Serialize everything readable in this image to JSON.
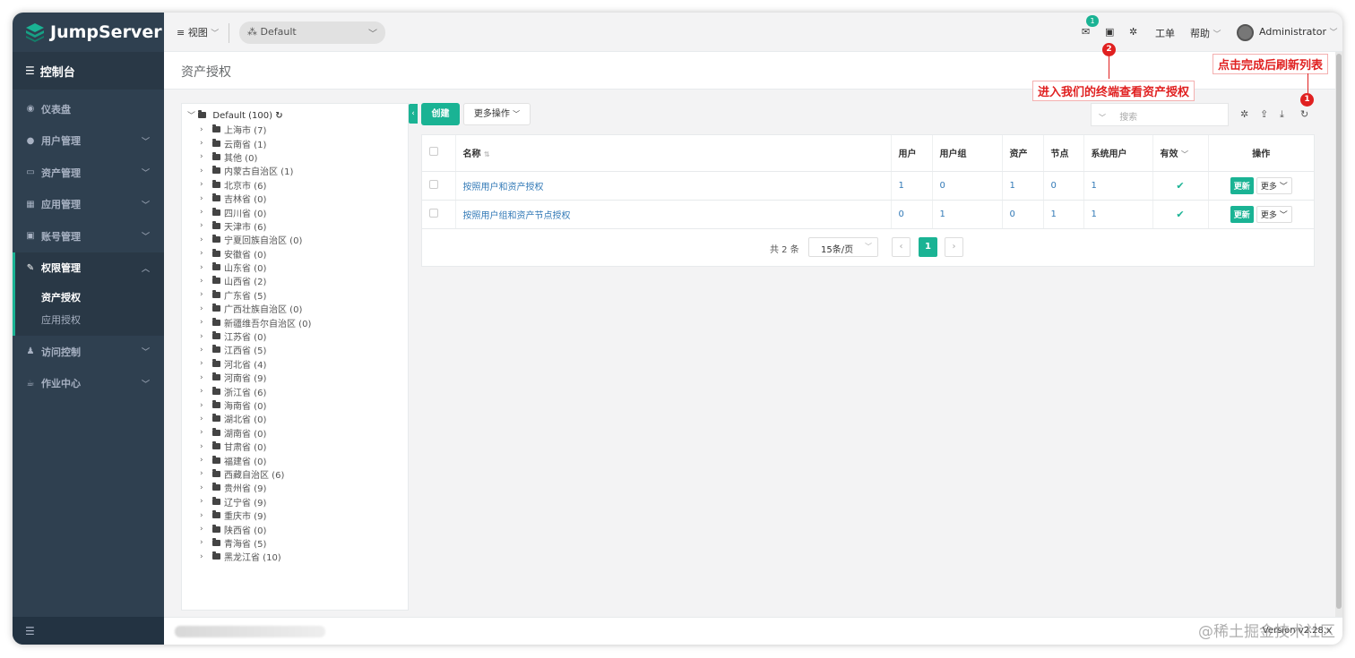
{
  "app": {
    "logo_text": "JumpServer",
    "console_label": "控制台",
    "page_title": "资产授权",
    "version": "Version v2.28.x",
    "watermark": "@稀土掘金技术社区"
  },
  "sidebar": {
    "items": [
      {
        "label": "仪表盘",
        "icon": "dashboard-icon"
      },
      {
        "label": "用户管理",
        "icon": "users-icon"
      },
      {
        "label": "资产管理",
        "icon": "inbox-icon"
      },
      {
        "label": "应用管理",
        "icon": "grid-icon"
      },
      {
        "label": "账号管理",
        "icon": "book-icon"
      },
      {
        "label": "权限管理",
        "icon": "edit-icon"
      },
      {
        "label": "访问控制",
        "icon": "sitemap-icon"
      },
      {
        "label": "作业中心",
        "icon": "coffee-icon"
      }
    ],
    "perm_sub": [
      {
        "label": "资产授权"
      },
      {
        "label": "应用授权"
      }
    ]
  },
  "topbar": {
    "view_label": "视图",
    "org_label": "Default",
    "mail_count": "1",
    "ticket_label": "工单",
    "help_label": "帮助",
    "user_label": "Administrator"
  },
  "annotations": {
    "terminal_note": "进入我们的终端查看资产授权",
    "terminal_num": "2",
    "refresh_note": "点击完成后刷新列表",
    "refresh_num": "1"
  },
  "tree": {
    "root": "Default (100)",
    "nodes": [
      "上海市 (7)",
      "云南省 (1)",
      "其他 (0)",
      "内蒙古自治区 (1)",
      "北京市 (6)",
      "吉林省 (0)",
      "四川省 (0)",
      "天津市 (6)",
      "宁夏回族自治区 (0)",
      "安徽省 (0)",
      "山东省 (0)",
      "山西省 (2)",
      "广东省 (5)",
      "广西壮族自治区 (0)",
      "新疆维吾尔自治区 (0)",
      "江苏省 (0)",
      "江西省 (5)",
      "河北省 (4)",
      "河南省 (9)",
      "浙江省 (6)",
      "海南省 (0)",
      "湖北省 (0)",
      "湖南省 (0)",
      "甘肃省 (0)",
      "福建省 (0)",
      "西藏自治区 (6)",
      "贵州省 (9)",
      "辽宁省 (9)",
      "重庆市 (9)",
      "陕西省 (0)",
      "青海省 (5)",
      "黑龙江省 (10)"
    ]
  },
  "toolbar": {
    "create_label": "创建",
    "more_ops_label": "更多操作",
    "search_placeholder": "搜索"
  },
  "table": {
    "headers": [
      "名称",
      "用户",
      "用户组",
      "资产",
      "节点",
      "系统用户",
      "有效",
      "操作"
    ],
    "rows": [
      {
        "name": "按照用户和资产授权",
        "users": "1",
        "groups": "0",
        "assets": "1",
        "nodes": "0",
        "sysusers": "1"
      },
      {
        "name": "按照用户组和资产节点授权",
        "users": "0",
        "groups": "1",
        "assets": "0",
        "nodes": "1",
        "sysusers": "1"
      }
    ],
    "update_label": "更新",
    "more_label": "更多"
  },
  "pager": {
    "total": "共 2 条",
    "page_size": "15条/页",
    "current_page": "1"
  },
  "colors": {
    "primary": "#1ab394",
    "sidebar": "#2f4050",
    "annotation": "#e02020",
    "link": "#337ab7"
  }
}
